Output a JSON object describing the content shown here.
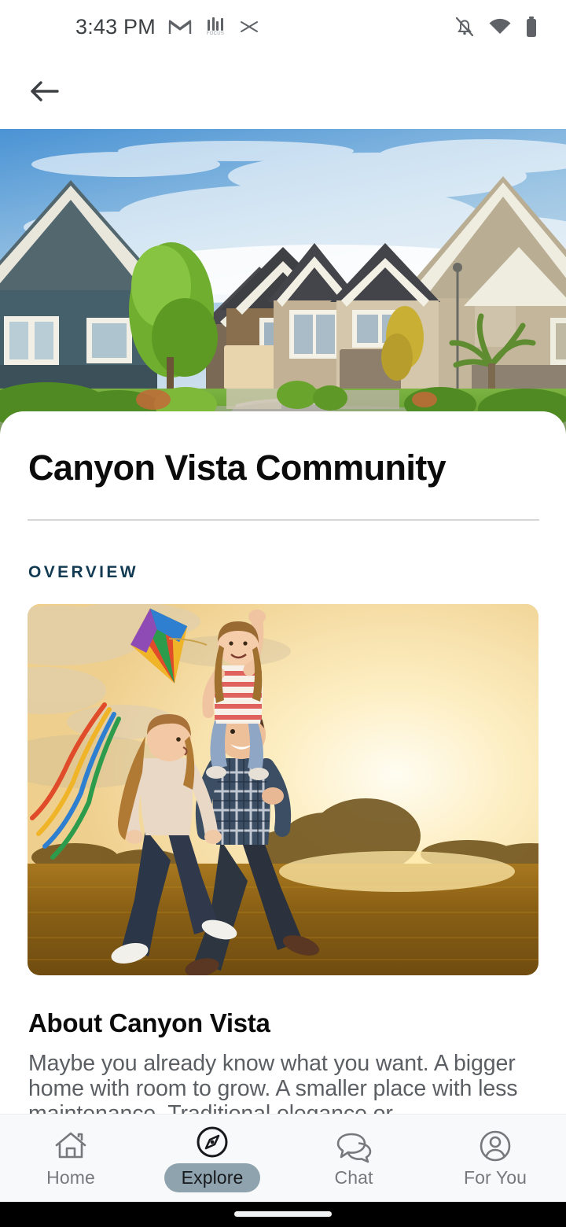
{
  "status_bar": {
    "time": "3:43 PM",
    "left_icons": [
      {
        "name": "gmail-icon",
        "label": "M"
      },
      {
        "name": "focus-icon",
        "label": "FOCUS"
      },
      {
        "name": "shuffle-icon",
        "label": "shuffle"
      }
    ],
    "right_icons": [
      {
        "name": "notifications-off-icon",
        "label": "notifications off"
      },
      {
        "name": "wifi-icon",
        "label": "wifi"
      },
      {
        "name": "battery-icon",
        "label": "battery full"
      }
    ]
  },
  "app_bar": {
    "back_label": "Back"
  },
  "hero": {
    "alt": "Suburban neighborhood street with houses and cul-de-sac"
  },
  "content": {
    "page_title": "Canyon Vista Community",
    "section_label": "OVERVIEW",
    "photo_alt": "Family running in a golden field flying a rainbow kite at sunset",
    "about_title": "About Canyon Vista",
    "about_body": "Maybe you already know what you want. A bigger home with room to grow. A smaller place with less maintenance. Traditional elegance or"
  },
  "bottom_nav": {
    "items": [
      {
        "label": "Home",
        "icon": "home-icon",
        "active": false
      },
      {
        "label": "Explore",
        "icon": "compass-icon",
        "active": true
      },
      {
        "label": "Chat",
        "icon": "chat-bubbles-icon",
        "active": false
      },
      {
        "label": "For You",
        "icon": "person-circle-icon",
        "active": false
      }
    ]
  },
  "colors": {
    "accent_navy": "#123a52",
    "active_pill": "#8ea3ad",
    "text_primary": "#0b0b0b",
    "text_secondary": "#5b5f63",
    "nav_bg": "#f8f9fa"
  }
}
